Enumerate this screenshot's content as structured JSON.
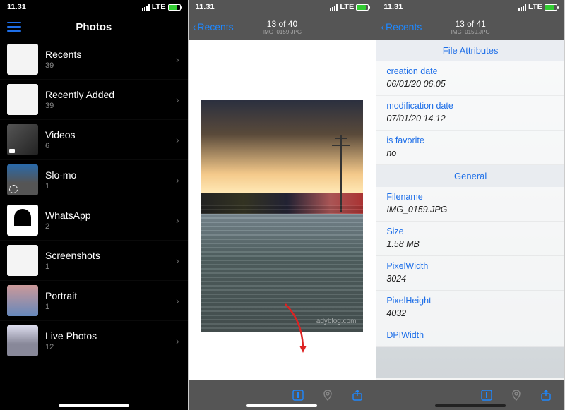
{
  "status": {
    "time": "11.31",
    "net": "LTE"
  },
  "p1": {
    "title": "Photos",
    "albums": [
      {
        "name": "Recents",
        "count": "39",
        "thumb": "white"
      },
      {
        "name": "Recently Added",
        "count": "39",
        "thumb": "white"
      },
      {
        "name": "Videos",
        "count": "6",
        "thumb": "video"
      },
      {
        "name": "Slo-mo",
        "count": "1",
        "thumb": "slomo"
      },
      {
        "name": "WhatsApp",
        "count": "2",
        "thumb": "wa"
      },
      {
        "name": "Screenshots",
        "count": "1",
        "thumb": "white"
      },
      {
        "name": "Portrait",
        "count": "1",
        "thumb": "portrait"
      },
      {
        "name": "Live Photos",
        "count": "12",
        "thumb": "live"
      }
    ]
  },
  "p2": {
    "back": "Recents",
    "counter": "13 of 40",
    "filename": "IMG_0159.JPG",
    "watermark": "adyblog.com"
  },
  "p3": {
    "back": "Recents",
    "counter": "13 of 41",
    "filename": "IMG_0159.JPG",
    "sections": {
      "file_attributes": {
        "header": "File Attributes",
        "creation_date_k": "creation date",
        "creation_date_v": "06/01/20 06.05",
        "modification_date_k": "modification date",
        "modification_date_v": "07/01/20 14.12",
        "is_favorite_k": "is favorite",
        "is_favorite_v": "no"
      },
      "general": {
        "header": "General",
        "filename_k": "Filename",
        "filename_v": "IMG_0159.JPG",
        "size_k": "Size",
        "size_v": "1.58 MB",
        "pixelwidth_k": "PixelWidth",
        "pixelwidth_v": "3024",
        "pixelheight_k": "PixelHeight",
        "pixelheight_v": "4032",
        "dpiwidth_k": "DPIWidth"
      }
    }
  }
}
